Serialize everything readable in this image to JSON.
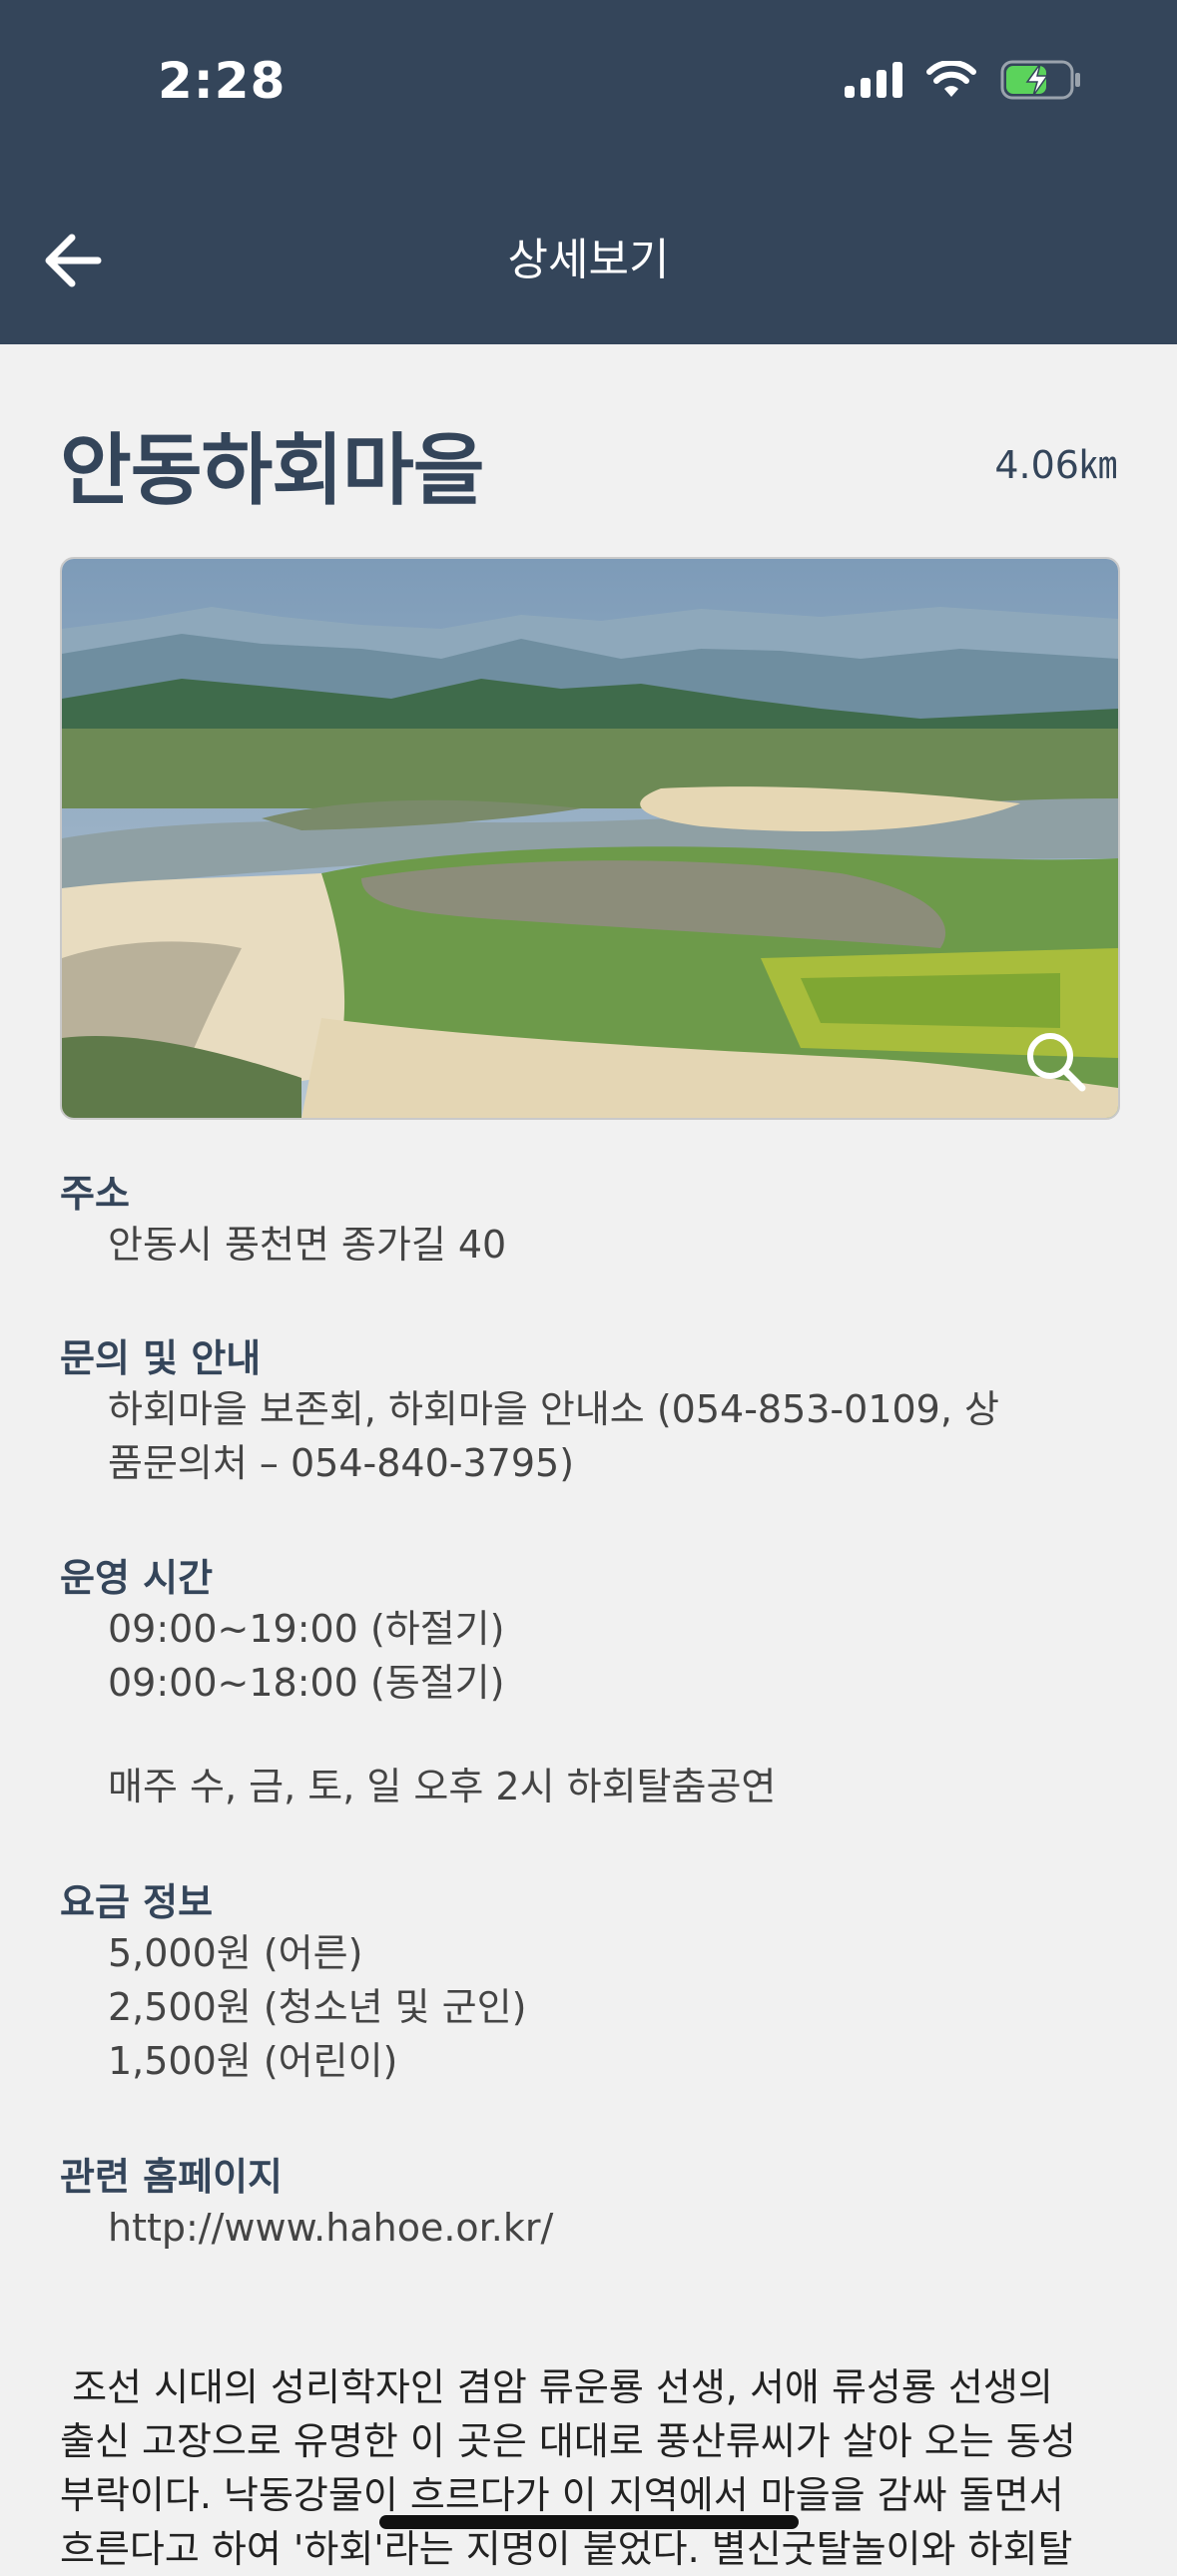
{
  "status": {
    "time": "2:28"
  },
  "header": {
    "title": "상세보기"
  },
  "place": {
    "name": "안동하회마을",
    "distance": "4.06㎞"
  },
  "info": {
    "address_label": "주소",
    "address": "안동시 풍천면 종가길 40",
    "contact_label": "문의 및 안내",
    "contact_line1": "하회마을 보존회, 하회마을 안내소 (054-853-0109, 상",
    "contact_line2": "품문의처 – 054-840-3795)",
    "hours_label": "운영 시간",
    "hours_line1": "09:00~19:00 (하절기)",
    "hours_line2": "09:00~18:00 (동절기)",
    "hours_note": "매주 수, 금, 토, 일 오후 2시 하회탈춤공연",
    "fee_label": "요금 정보",
    "fee_line1": "5,000원 (어른)",
    "fee_line2": "2,500원 (청소년 및 군인)",
    "fee_line3": "1,500원 (어린이)",
    "homepage_label": "관련 홈페이지",
    "homepage": "http://www.hahoe.or.kr/"
  },
  "description": {
    "line1": " 조선 시대의 성리학자인 겸암 류운룡 선생, 서애 류성룡 선생의",
    "line2": "출신 고장으로 유명한 이 곳은 대대로 풍산류씨가 살아 오는 동성",
    "line3": "부락이다. 낙동강물이 흐르다가 이 지역에서 마을을 감싸 돌면서",
    "line4": "흐른다고 하여 '하회'라는 지명이 붙었다. 별신굿탈놀이와 하회탈"
  },
  "icons": {
    "back": "arrow-left-icon",
    "zoom": "magnifier-icon",
    "signal": "signal-icon",
    "wifi": "wifi-icon",
    "battery": "battery-charging-icon"
  },
  "colors": {
    "header_bg": "#34455a",
    "accent": "#34455a",
    "battery": "#5bd35b"
  }
}
